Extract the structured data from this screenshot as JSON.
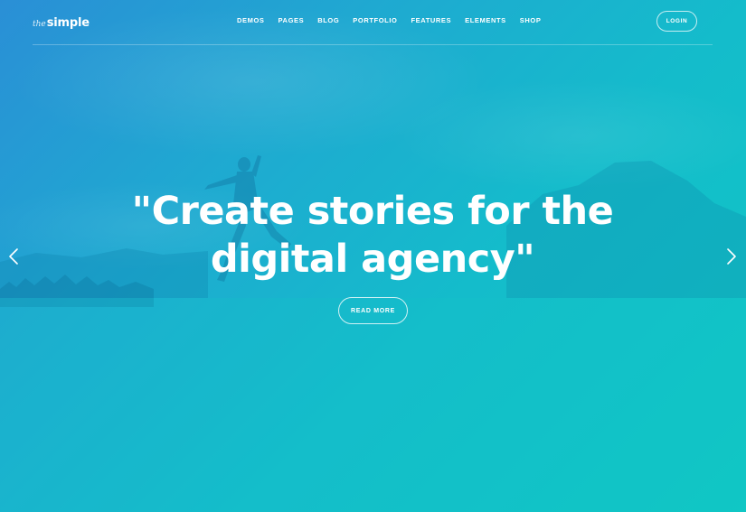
{
  "header": {
    "logo_prefix": "the",
    "logo_main": "simple",
    "nav": [
      "DEMOS",
      "PAGES",
      "BLOG",
      "PORTFOLIO",
      "FEATURES",
      "ELEMENTS",
      "SHOP"
    ],
    "login_label": "LOGIN"
  },
  "hero": {
    "headline_line1": "\"Create stories for the",
    "headline_line2": "digital agency\"",
    "cta_label": "READ MORE",
    "prev_icon": "chevron-left-icon",
    "next_icon": "chevron-right-icon"
  },
  "colors": {
    "gradient_start": "#2a8fd6",
    "gradient_end": "#0fc8c4",
    "text": "#ffffff"
  }
}
